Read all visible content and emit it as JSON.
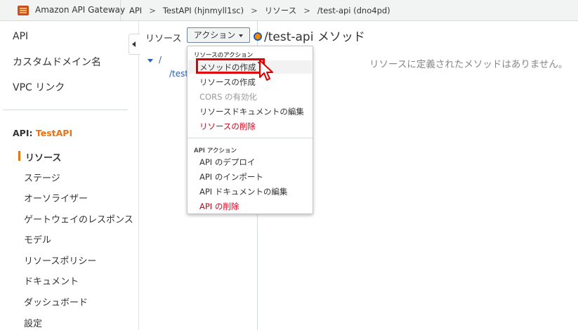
{
  "header": {
    "brand": "Amazon API Gateway",
    "breadcrumbs": [
      "API",
      "TestAPI (hjnmyll1sc)",
      "リソース",
      "/test-api (dno4pd)"
    ],
    "separator": ">"
  },
  "sidebar": {
    "top_items": [
      "API",
      "カスタムドメイン名",
      "VPC リンク"
    ],
    "api_prefix": "API: ",
    "api_name": "TestAPI",
    "items": [
      "リソース",
      "ステージ",
      "オーソライザー",
      "ゲートウェイのレスポンス",
      "モデル",
      "リソースポリシー",
      "ドキュメント",
      "ダッシュボード",
      "設定"
    ],
    "active_item": "リソース"
  },
  "resources_panel": {
    "label": "リソース",
    "actions_button": "アクション",
    "tree_root": "/",
    "tree_child": "/test"
  },
  "main": {
    "title": "/test-api メソッド",
    "empty_message": "リソースに定義されたメソッドはありません。"
  },
  "actions_menu": {
    "resource_header": "リソースのアクション",
    "resource_items": [
      {
        "label": "メソッドの作成",
        "state": "hover"
      },
      {
        "label": "リソースの作成",
        "state": "normal"
      },
      {
        "label": "CORS の有効化",
        "state": "disabled"
      },
      {
        "label": "リソースドキュメントの編集",
        "state": "normal"
      },
      {
        "label": "リソースの削除",
        "state": "danger"
      }
    ],
    "api_header": "API アクション",
    "api_items": [
      {
        "label": "API のデプロイ",
        "state": "normal"
      },
      {
        "label": "API のインポート",
        "state": "normal"
      },
      {
        "label": "API ドキュメントの編集",
        "state": "normal"
      },
      {
        "label": "API の削除",
        "state": "danger"
      }
    ]
  },
  "colors": {
    "accent": "#ec7211",
    "link": "#2a5db0",
    "danger": "#d0021b",
    "highlight": "#e00000"
  },
  "icons": [
    "api-gateway-logo-icon",
    "collapse-sidebar-icon",
    "tree-expand-icon",
    "resource-dot-icon",
    "pointer-cursor-icon"
  ]
}
